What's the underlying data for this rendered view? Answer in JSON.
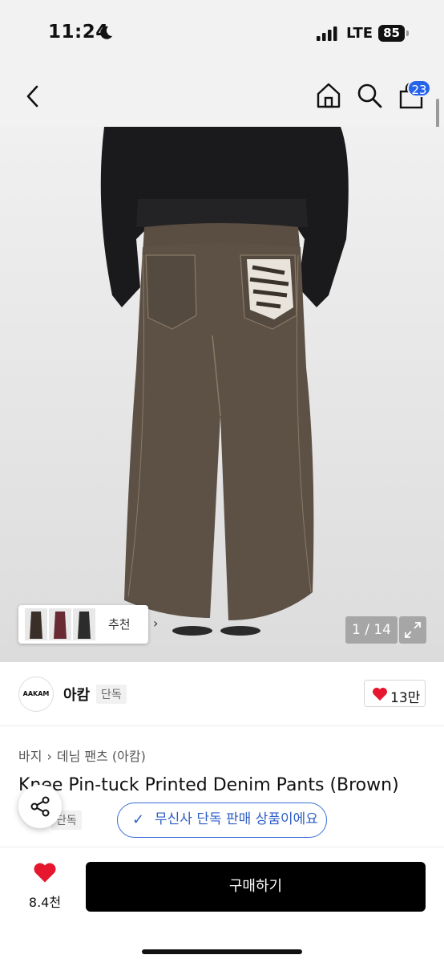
{
  "status_bar": {
    "time": "11:24",
    "carrier": "LTE",
    "battery": "85"
  },
  "nav": {
    "cart_count": "23"
  },
  "gallery": {
    "thumbnail_label": "추천",
    "counter": "1 / 14"
  },
  "brand": {
    "logo_text": "AAKAM",
    "name": "아캄",
    "tag": "단독",
    "likes": "13만"
  },
  "breadcrumb": {
    "items": [
      "바지",
      "데님 팬츠 (아캄)"
    ]
  },
  "product": {
    "title": "Knee Pin-tuck Printed Denim Pants (Brown)",
    "exclusive_tag": "단독",
    "notice": "무신사 단독 판매 상품이에요"
  },
  "bottom_bar": {
    "wish_count": "8.4천",
    "buy_label": "구매하기"
  },
  "colors": {
    "accent_blue": "#2563eb",
    "heart_red": "#e5162d",
    "button_black": "#000000"
  }
}
